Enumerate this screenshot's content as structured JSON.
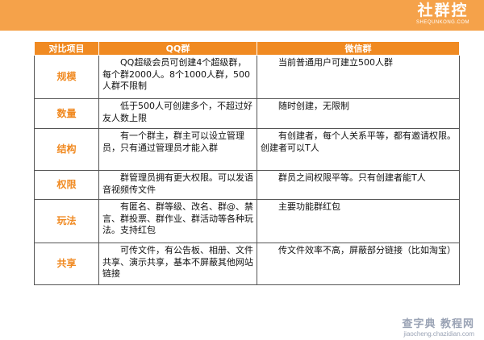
{
  "header": {
    "logo_text": "社群控",
    "logo_sub": "SHEQUNKONG.COM",
    "accent_color": "#f5a24a"
  },
  "table": {
    "header_color": "#f08a22",
    "columns": [
      "对比项目",
      "QQ群",
      "微信群"
    ],
    "rows": [
      {
        "label": "规模",
        "qq": "QQ超级会员可创建4个超级群，每个群2000人。8个1000人群，500人群不限制",
        "wechat": "当前普通用户可建立500人群"
      },
      {
        "label": "数量",
        "qq": "低于500人可创建多个，不超过好友人数上限",
        "wechat": "随时创建，无限制"
      },
      {
        "label": "结构",
        "qq": "有一个群主，群主可以设立管理员，只有通过管理员才能入群",
        "wechat": "有创建者，每个人关系平等，都有邀请权限。创建者可以T人"
      },
      {
        "label": "权限",
        "qq": "群管理员拥有更大权限。可以发语音视频传文件",
        "wechat": "群员之间权限平等。只有创建者能T人"
      },
      {
        "label": "玩法",
        "qq": "有匿名、群等级、改名、群@、禁言、群投票、群作业、群活动等各种玩法。支持红包",
        "wechat": "主要功能群红包"
      },
      {
        "label": "共享",
        "qq": "可传文件，有公告板、相册、文件共享、演示共享，基本不屏蔽其他网站链接",
        "wechat": "传文件效率不高，屏蔽部分链接（比如淘宝）"
      }
    ]
  },
  "watermark": {
    "main": "查字典 教程网",
    "sub": "jiaocheng.chazidian.com"
  }
}
